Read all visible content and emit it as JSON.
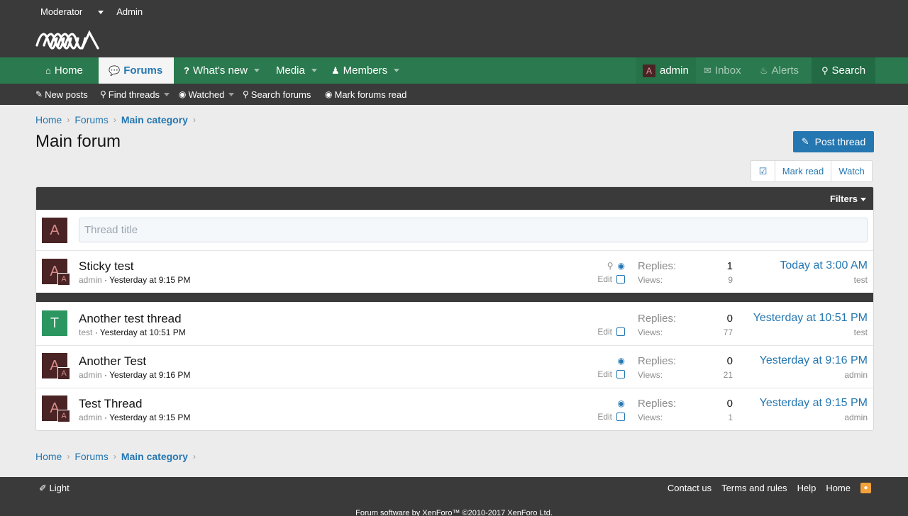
{
  "staff_bar": {
    "moderator": "Moderator",
    "admin": "Admin"
  },
  "nav": {
    "home": "Home",
    "forums": "Forums",
    "whats_new": "What's new",
    "media": "Media",
    "members": "Members",
    "user_initial": "A",
    "user": "admin",
    "inbox": "Inbox",
    "alerts": "Alerts",
    "search": "Search"
  },
  "subnav": {
    "new_posts": "New posts",
    "find_threads": "Find threads",
    "watched": "Watched",
    "search_forums": "Search forums",
    "mark_read": "Mark forums read"
  },
  "breadcrumb": {
    "home": "Home",
    "forums": "Forums",
    "category": "Main category"
  },
  "page": {
    "title": "Main forum",
    "post_thread": "Post thread"
  },
  "actions": {
    "mark_read": "Mark read",
    "watch": "Watch"
  },
  "list": {
    "filters": "Filters",
    "quick_avatar": "A",
    "thread_title_placeholder": "Thread title",
    "replies_label": "Replies:",
    "views_label": "Views:",
    "edit_label": "Edit",
    "threads": [
      {
        "title": "Sticky test",
        "author": "admin",
        "date": "Yesterday at 9:15 PM",
        "replies": "1",
        "views": "9",
        "last_date": "Today at 3:00 AM",
        "last_user": "test",
        "avatar": "A",
        "sub_avatar": "A"
      },
      {
        "title": "Another test thread",
        "author": "test",
        "date": "Yesterday at 10:51 PM",
        "replies": "0",
        "views": "77",
        "last_date": "Yesterday at 10:51 PM",
        "last_user": "test",
        "avatar": "T"
      },
      {
        "title": "Another Test",
        "author": "admin",
        "date": "Yesterday at 9:16 PM",
        "replies": "0",
        "views": "21",
        "last_date": "Yesterday at 9:16 PM",
        "last_user": "admin",
        "avatar": "A",
        "sub_avatar": "A"
      },
      {
        "title": "Test Thread",
        "author": "admin",
        "date": "Yesterday at 9:15 PM",
        "replies": "0",
        "views": "1",
        "last_date": "Yesterday at 9:15 PM",
        "last_user": "admin",
        "avatar": "A",
        "sub_avatar": "A"
      }
    ]
  },
  "footer": {
    "style": "Light",
    "contact": "Contact us",
    "terms": "Terms and rules",
    "help": "Help",
    "home": "Home",
    "copyright": "Forum software by XenForo™ ©2010-2017 XenForo Ltd."
  },
  "colors": {
    "nav_green": "#2b7a4f",
    "dark": "#3a3a3a",
    "link_blue": "#2577b1"
  }
}
